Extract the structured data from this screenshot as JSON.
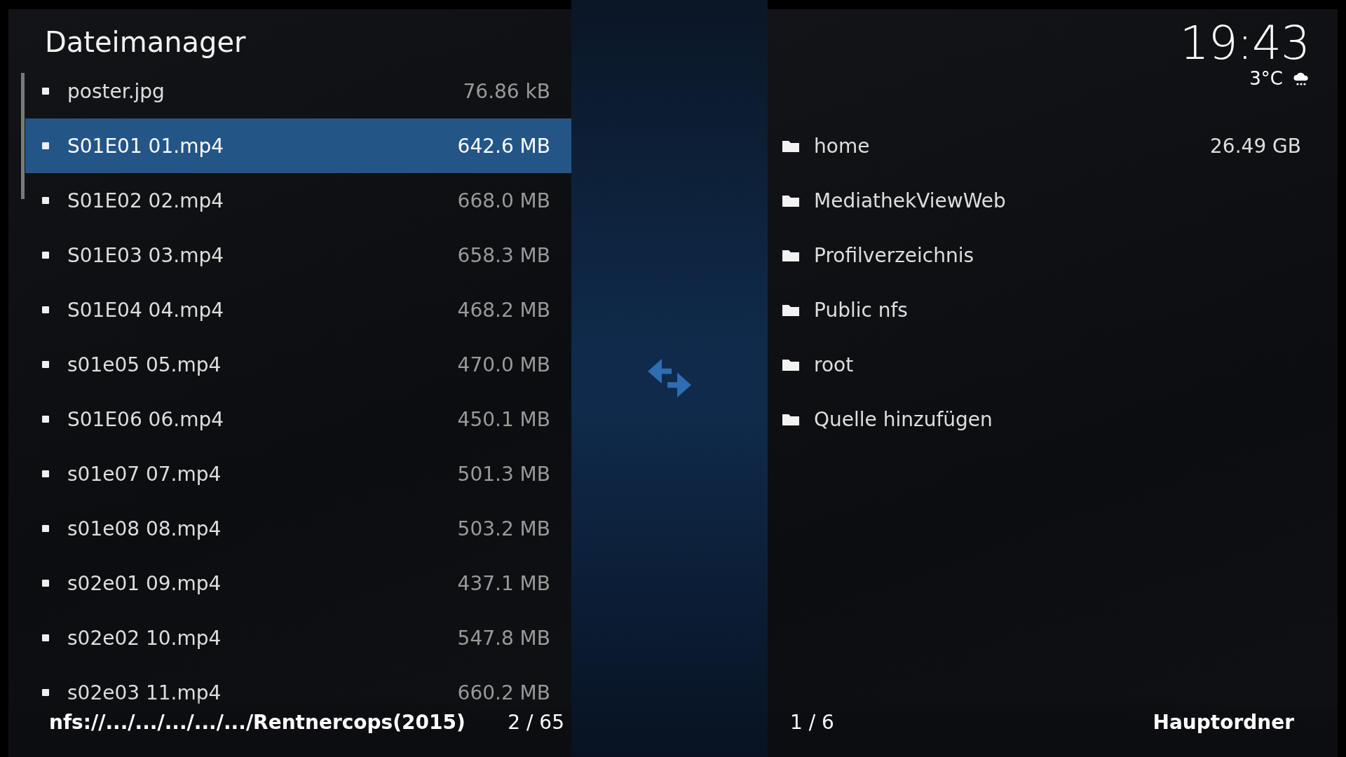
{
  "title": "Dateimanager",
  "clock": {
    "time": "19:43",
    "temperature": "3°C"
  },
  "left_pane": {
    "items": [
      {
        "name": "poster.jpg",
        "size": "76.86 kB",
        "selected": false
      },
      {
        "name": "S01E01 01.mp4",
        "size": "642.6 MB",
        "selected": true
      },
      {
        "name": "S01E02 02.mp4",
        "size": "668.0 MB",
        "selected": false
      },
      {
        "name": "S01E03 03.mp4",
        "size": "658.3 MB",
        "selected": false
      },
      {
        "name": "S01E04 04.mp4",
        "size": "468.2 MB",
        "selected": false
      },
      {
        "name": "s01e05 05.mp4",
        "size": "470.0 MB",
        "selected": false
      },
      {
        "name": "S01E06 06.mp4",
        "size": "450.1 MB",
        "selected": false
      },
      {
        "name": "s01e07 07.mp4",
        "size": "501.3 MB",
        "selected": false
      },
      {
        "name": "s01e08 08.mp4",
        "size": "503.2 MB",
        "selected": false
      },
      {
        "name": "s02e01 09.mp4",
        "size": "437.1 MB",
        "selected": false
      },
      {
        "name": "s02e02 10.mp4",
        "size": "547.8 MB",
        "selected": false
      },
      {
        "name": "s02e03 11.mp4",
        "size": "660.2 MB",
        "selected": false
      }
    ],
    "path": "nfs://.../.../.../.../.../Rentnercops(2015)",
    "position": "2 / 65"
  },
  "right_pane": {
    "items": [
      {
        "name": "home",
        "size": "26.49 GB"
      },
      {
        "name": "MediathekViewWeb"
      },
      {
        "name": "Profilverzeichnis"
      },
      {
        "name": "Public nfs"
      },
      {
        "name": "root"
      },
      {
        "name": "Quelle hinzufügen"
      }
    ],
    "position": "1 / 6",
    "label": "Hauptordner"
  }
}
